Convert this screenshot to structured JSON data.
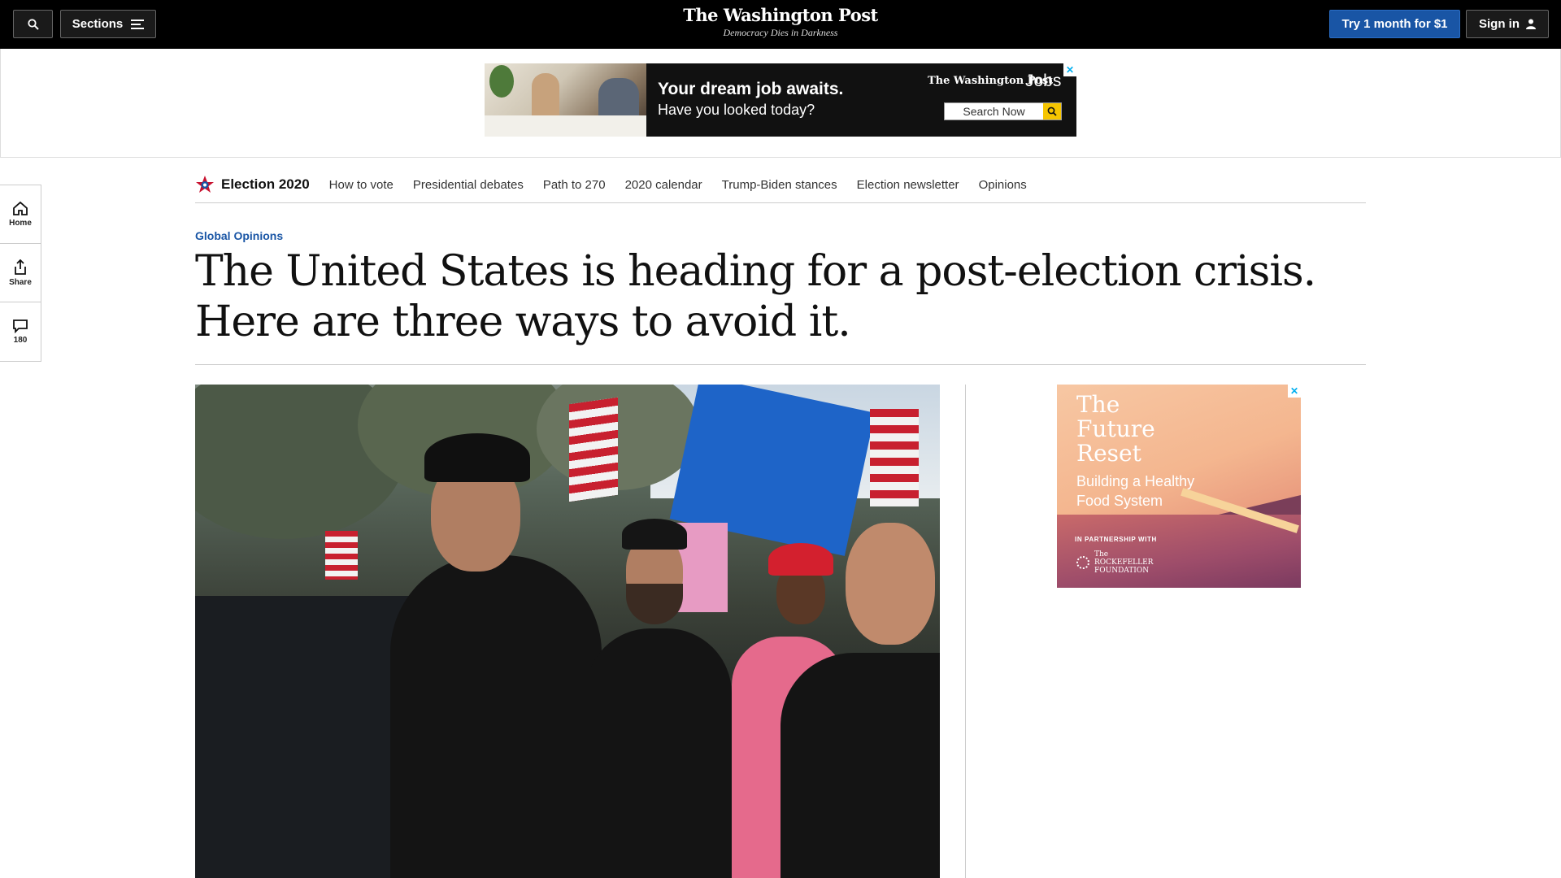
{
  "header": {
    "search_label": "",
    "sections_label": "Sections",
    "logo_title": "The Washington Post",
    "logo_tagline": "Democracy Dies in Darkness",
    "subscribe_label": "Try 1 month for $1",
    "signin_label": "Sign in"
  },
  "top_ad": {
    "headline": "Your dream job awaits.",
    "subline": "Have you looked today?",
    "brand": "The Washington Post",
    "brand_suffix": "Jobs",
    "search_label": "Search Now",
    "close": "✕"
  },
  "left_rail": {
    "home_label": "Home",
    "share_label": "Share",
    "comments_count": "180"
  },
  "election_nav": {
    "brand": "Election 2020",
    "links": [
      "How to vote",
      "Presidential debates",
      "Path to 270",
      "2020 calendar",
      "Trump-Biden stances",
      "Election newsletter",
      "Opinions"
    ]
  },
  "article": {
    "kicker": "Global Opinions",
    "headline": "The United States is heading for a post-election crisis. Here are three ways to avoid it."
  },
  "side_ad": {
    "title": "The Future Reset",
    "subtitle": "Building a Healthy Food System",
    "partner_label": "IN PARTNERSHIP WITH",
    "partner_name_line1": "The",
    "partner_name_line2": "ROCKEFELLER",
    "partner_name_line3": "FOUNDATION",
    "close": "✕"
  },
  "colors": {
    "accent_blue": "#1955a5",
    "header_bg": "#000000"
  }
}
